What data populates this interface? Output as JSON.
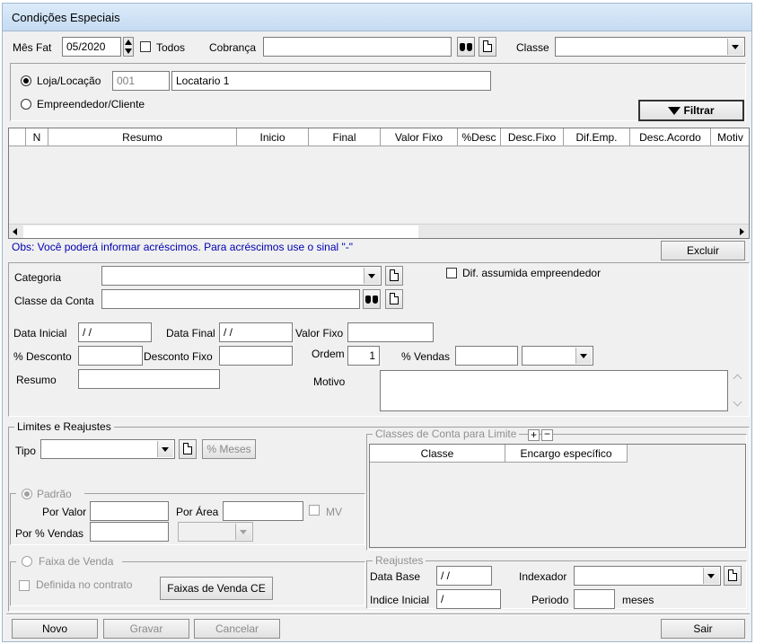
{
  "window": {
    "title": "Condições Especiais"
  },
  "filter": {
    "mes_fat_label": "Mês Fat",
    "mes_fat_value": "05/2020",
    "todos_label": "Todos",
    "cobranca_label": "Cobrança",
    "cobranca_value": "",
    "classe_label": "Classe",
    "classe_value": "",
    "loja_label": "Loja/Locação",
    "loja_code": "001",
    "loja_name": "Locatario 1",
    "empreendedor_label": "Empreendedor/Cliente",
    "filtrar_label": "Filtrar"
  },
  "grid": {
    "columns": [
      "",
      "N",
      "Resumo",
      "Inicio",
      "Final",
      "Valor Fixo",
      "%Desc",
      "Desc.Fixo",
      "Dif.Emp.",
      "Desc.Acordo",
      "Motiv"
    ],
    "rows": []
  },
  "obs_text": "Obs: Você poderá informar acréscimos. Para acréscimos use o sinal \"-\"",
  "excluir_label": "Excluir",
  "form": {
    "categoria_label": "Categoria",
    "dif_assumida_label": "Dif. assumida empreendedor",
    "classe_conta_label": "Classe da Conta",
    "data_inicial_label": "Data Inicial",
    "data_inicial_value": " / /",
    "data_final_label": "Data Final",
    "data_final_value": " / /",
    "valor_fixo_label": "Valor Fixo",
    "desconto_label": "% Desconto",
    "desconto_fixo_label": "Desconto Fixo",
    "ordem_label": "Ordem",
    "ordem_value": "1",
    "vendas_label": "% Vendas",
    "resumo_label": "Resumo",
    "motivo_label": "Motivo"
  },
  "limites": {
    "title": "Limites e Reajustes",
    "tipo_label": "Tipo",
    "meses_label": "% Meses",
    "padrao_label": "Padrão",
    "por_valor_label": "Por Valor",
    "por_area_label": "Por Área",
    "mv_label": "MV",
    "por_vendas_label": "Por % Vendas",
    "faixa_label": "Faixa de Venda",
    "definida_label": "Definida no contrato",
    "faixas_btn_label": "Faixas de Venda CE",
    "classes_title": "Classes de Conta para Limite",
    "classes_columns": [
      "Classe",
      "Encargo específico"
    ],
    "reajustes_title": "Reajustes",
    "data_base_label": "Data Base",
    "data_base_value": " / /",
    "indexador_label": "Indexador",
    "indice_inicial_label": "Indice Inicial",
    "indice_inicial_value": " /",
    "periodo_label": "Periodo",
    "meses_suffix": "meses"
  },
  "footer": {
    "novo": "Novo",
    "gravar": "Gravar",
    "cancelar": "Cancelar",
    "sair": "Sair"
  }
}
